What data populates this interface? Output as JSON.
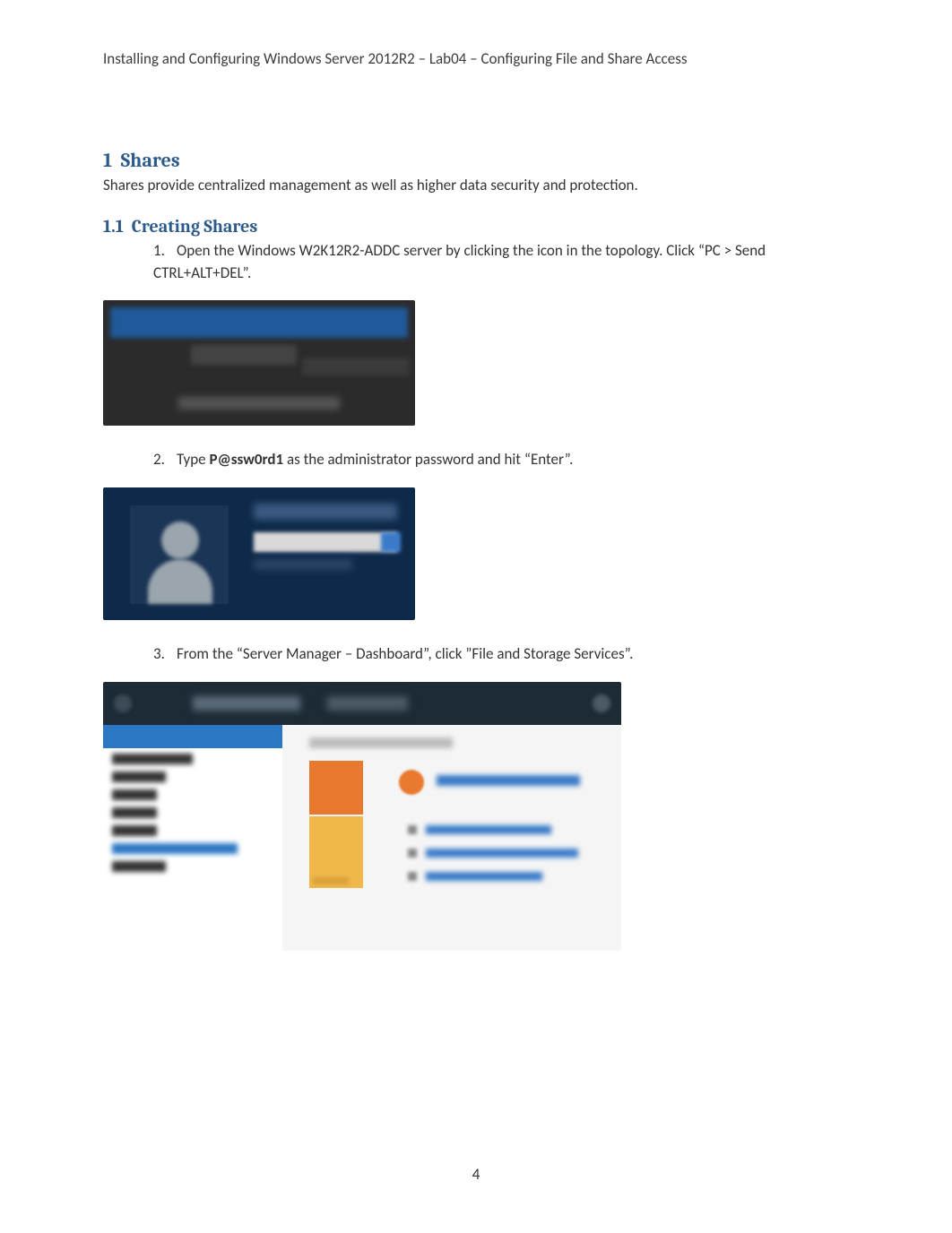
{
  "header": "Installing and Configuring Windows Server 2012R2 – Lab04 – Configuring File and Share Access",
  "section1": {
    "number": "1",
    "title": "Shares",
    "intro": "Shares provide centralized management as well as higher data security and protection."
  },
  "section11": {
    "number": "1.1",
    "title": "Creating Shares"
  },
  "steps": [
    {
      "num": "1.",
      "text_before": "Open the Windows W2K12R2-ADDC server by clicking the icon in the topology. Click “PC > Send CTRL+ALT+DEL”."
    },
    {
      "num": "2.",
      "text_before": "Type ",
      "bold": "P@ssw0rd1",
      "text_after": " as the administrator password and hit “Enter”."
    },
    {
      "num": "3.",
      "text_before": "From the “Server Manager – Dashboard”, click ”File and Storage Services”."
    }
  ],
  "page_number": "4"
}
